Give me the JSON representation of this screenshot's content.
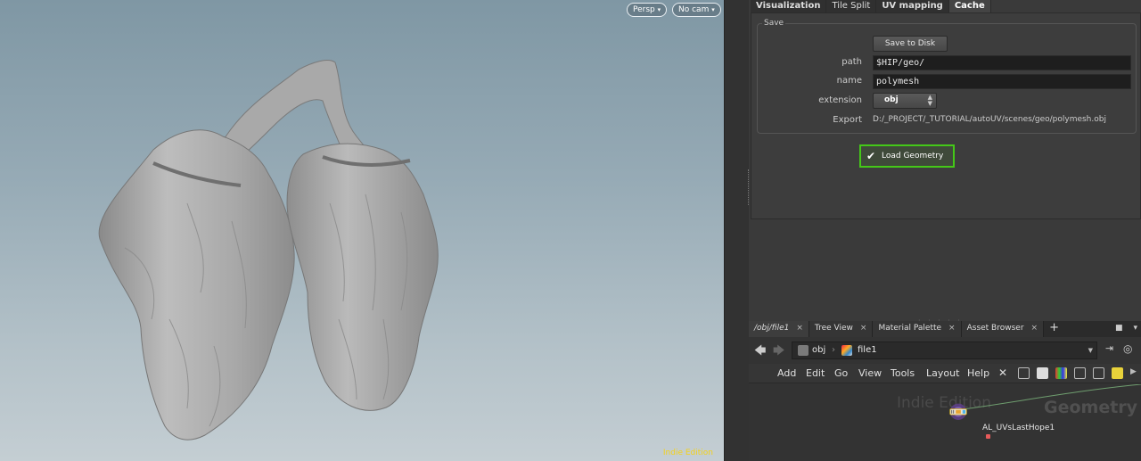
{
  "viewport": {
    "camera_type": "Persp",
    "camera_name": "No cam",
    "watermark": "Indie Edition"
  },
  "param_tabs": [
    "Visualization",
    "Tile Split",
    "UV mapping",
    "Cache"
  ],
  "save_group": {
    "label": "Save",
    "save_button": "Save to Disk",
    "path_label": "path",
    "path_value": "$HIP/geo/",
    "name_label": "name",
    "name_value": "polymesh",
    "extension_label": "extension",
    "extension_value": "obj",
    "export_label": "Export",
    "export_value": "D:/_PROJECT/_TUTORIAL/autoUV/scenes/geo/polymesh.obj"
  },
  "load_geometry": {
    "label": "Load Geometry",
    "checked": true,
    "highlight_color": "#44c818"
  },
  "network": {
    "tabs": [
      {
        "label": "/obj/file1",
        "close": "×"
      },
      {
        "label": "Tree View",
        "close": "×"
      },
      {
        "label": "Material Palette",
        "close": "×"
      },
      {
        "label": "Asset Browser",
        "close": "×"
      }
    ],
    "add_tab": "+",
    "path": {
      "root": "obj",
      "current": "file1"
    },
    "menus": [
      "Add",
      "Edit",
      "Go",
      "View",
      "Tools",
      "Layout",
      "Help"
    ],
    "watermark_edition": "Indie Edition",
    "watermark_context": "Geometry",
    "node": {
      "label": "AL_UVsLastHope1",
      "flag_color": "#e65a5a"
    }
  }
}
